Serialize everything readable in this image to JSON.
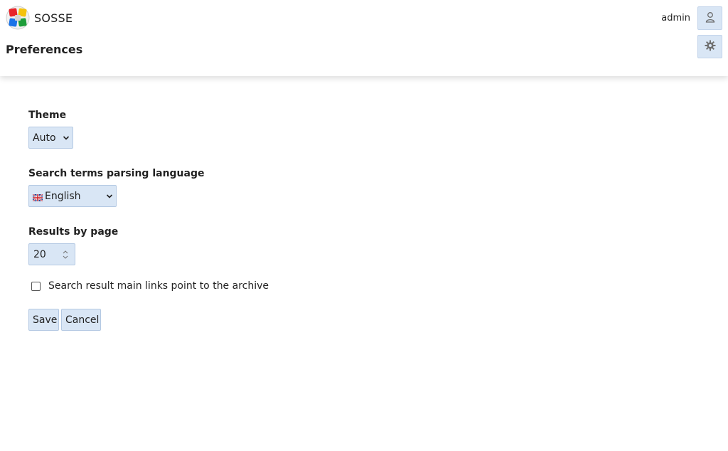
{
  "header": {
    "brand": "SOSSE",
    "page_title": "Preferences",
    "username": "admin",
    "user_icon": "user-icon",
    "settings_icon": "gear-icon",
    "logo_colors": [
      "#e8242a",
      "#f4c20d",
      "#1a73e8",
      "#1e9e3a"
    ]
  },
  "form": {
    "theme": {
      "label": "Theme",
      "value": "Auto"
    },
    "language": {
      "label": "Search terms parsing language",
      "value": "English",
      "flag_icon": "uk-flag-icon"
    },
    "results": {
      "label": "Results by page",
      "value": "20"
    },
    "archive_links": {
      "label": "Search result main links point to the archive",
      "checked": false
    },
    "save_label": "Save",
    "cancel_label": "Cancel"
  },
  "colors": {
    "control_bg": "#d9e6f5",
    "control_border": "#b4c9e3"
  }
}
